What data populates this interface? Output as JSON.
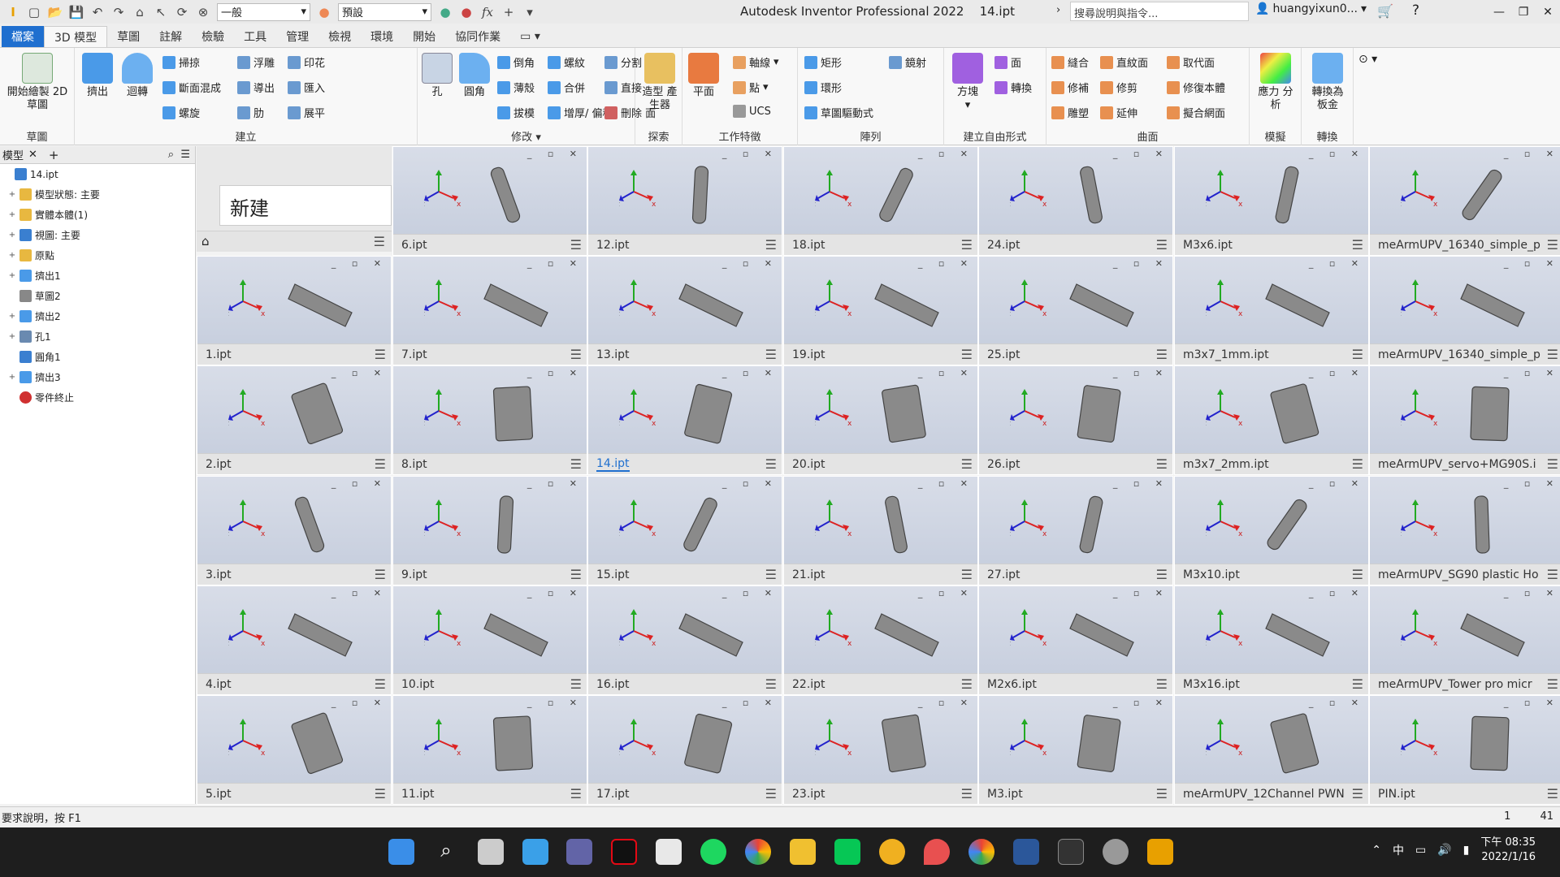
{
  "titlebar": {
    "style_select": "一般",
    "appearance_select": "預設",
    "app_title": "Autodesk Inventor Professional 2022",
    "document": "14.ipt",
    "search_placeholder": "搜尋說明與指令...",
    "user": "huangyixun0..."
  },
  "tabs": [
    "檔案",
    "3D 模型",
    "草圖",
    "註解",
    "檢驗",
    "工具",
    "管理",
    "檢視",
    "環境",
    "開始",
    "協同作業"
  ],
  "ribbon": {
    "sketch": {
      "start_label": "開始繪製 2D 草圖",
      "group": "草圖"
    },
    "create": {
      "extrude": "擠出",
      "revolve": "迴轉",
      "items": [
        "掃掠",
        "斷面混成",
        "螺旋",
        "浮雕",
        "導出",
        "肋",
        "印花",
        "匯入",
        "展平"
      ],
      "group": "建立"
    },
    "modify": {
      "hole": "孔",
      "fillet": "圓角",
      "items": [
        "倒角",
        "薄殼",
        "拔模",
        "螺紋",
        "合併",
        "增厚/ 偏移",
        "分割",
        "直接",
        "刪除 面"
      ],
      "group": "修改"
    },
    "explore": {
      "label": "造型 產生器",
      "group": "探索"
    },
    "work": {
      "plane": "平面",
      "items": [
        "軸線",
        "點",
        "UCS"
      ],
      "group": "工作特徵"
    },
    "pattern": {
      "items": [
        "矩形",
        "環形",
        "草圖驅動式",
        "鏡射"
      ],
      "group": "陣列"
    },
    "freeform": {
      "box": "方塊",
      "items": [
        "面",
        "轉換"
      ],
      "group": "建立自由形式"
    },
    "surface": {
      "items": [
        "縫合",
        "直紋面",
        "取代面",
        "修補",
        "修剪",
        "修復本體",
        "雕塑",
        "延伸",
        "擬合網面"
      ],
      "group": "曲面"
    },
    "simulation": {
      "label": "應力 分析",
      "group": "模擬"
    },
    "convert": {
      "label": "轉換為 板金",
      "group": "轉換"
    }
  },
  "browser": {
    "title": "模型",
    "items": [
      {
        "label": "14.ipt",
        "expand": ""
      },
      {
        "label": "模型狀態: 主要",
        "expand": "+"
      },
      {
        "label": "實體本體(1)",
        "expand": "+"
      },
      {
        "label": "視圖: 主要",
        "expand": "+"
      },
      {
        "label": "原點",
        "expand": "+"
      },
      {
        "label": "擠出1",
        "expand": "+"
      },
      {
        "label": "草圖2",
        "expand": ""
      },
      {
        "label": "擠出2",
        "expand": "+"
      },
      {
        "label": "孔1",
        "expand": "+"
      },
      {
        "label": "圓角1",
        "expand": ""
      },
      {
        "label": "擠出3",
        "expand": "+"
      },
      {
        "label": "零件終止",
        "expand": ""
      }
    ]
  },
  "new_panel": {
    "label": "新建"
  },
  "tiles": [
    [
      "6.ipt",
      "12.ipt",
      "18.ipt",
      "24.ipt",
      "M3x6.ipt",
      "meArmUPV_16340_simple_p"
    ],
    [
      "1.ipt",
      "7.ipt",
      "13.ipt",
      "19.ipt",
      "25.ipt",
      "m3x7_1mm.ipt",
      "meArmUPV_16340_simple_p"
    ],
    [
      "2.ipt",
      "8.ipt",
      "14.ipt",
      "20.ipt",
      "26.ipt",
      "m3x7_2mm.ipt",
      "meArmUPV_servo+MG90S.i"
    ],
    [
      "3.ipt",
      "9.ipt",
      "15.ipt",
      "21.ipt",
      "27.ipt",
      "M3x10.ipt",
      "meArmUPV_SG90 plastic Ho"
    ],
    [
      "4.ipt",
      "10.ipt",
      "16.ipt",
      "22.ipt",
      "M2x6.ipt",
      "M3x16.ipt",
      "meArmUPV_Tower pro micr"
    ],
    [
      "5.ipt",
      "11.ipt",
      "17.ipt",
      "23.ipt",
      "M3.ipt",
      "meArmUPV_12Channel PWN",
      "PIN.ipt"
    ]
  ],
  "active_tile": "14.ipt",
  "status": {
    "help": "要求說明，按 F1",
    "count1": "1",
    "count2": "41"
  },
  "taskbar": {
    "ime": "中",
    "time": "下午 08:35",
    "date": "2022/1/16"
  },
  "colors": {
    "accent": "#1f6fcf",
    "tile_bg": "#cbd2e0",
    "taskbar": "#1e1e1e"
  }
}
